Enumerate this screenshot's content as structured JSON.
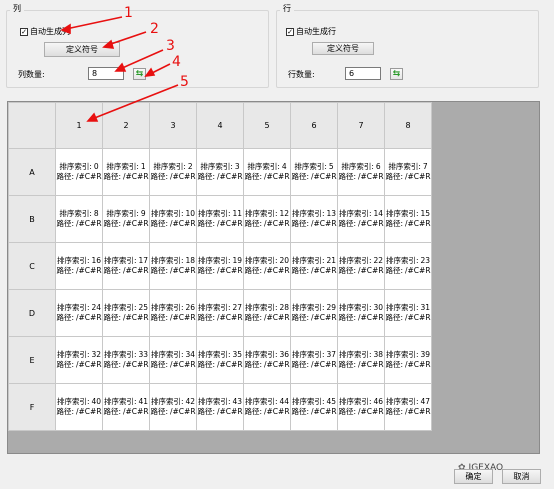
{
  "column_group": {
    "title": "列",
    "auto_generate_label": "自动生成列",
    "auto_generate_checked": "✓",
    "define_symbol_label": "定义符号",
    "count_label": "列数量:",
    "count_value": "8",
    "refresh_glyph": "⇆"
  },
  "row_group": {
    "title": "行",
    "auto_generate_label": "自动生成行",
    "auto_generate_checked": "✓",
    "define_symbol_label": "定义符号",
    "count_label": "行数量:",
    "count_value": "6",
    "refresh_glyph": "⇆"
  },
  "annotations": [
    "1",
    "2",
    "3",
    "4",
    "5"
  ],
  "annotation_color": "#e81010",
  "grid": {
    "column_headers": [
      "1",
      "2",
      "3",
      "4",
      "5",
      "6",
      "7",
      "8"
    ],
    "row_headers": [
      "A",
      "B",
      "C",
      "D",
      "E",
      "F"
    ],
    "cell_index_label": "排序索引:",
    "cell_path_label": "路径:",
    "cell_path_value": "/#C#R",
    "indices": [
      [
        "0",
        "1",
        "2",
        "3",
        "4",
        "5",
        "6",
        "7"
      ],
      [
        "8",
        "9",
        "10",
        "11",
        "12",
        "13",
        "14",
        "15"
      ],
      [
        "16",
        "17",
        "18",
        "19",
        "20",
        "21",
        "22",
        "23"
      ],
      [
        "24",
        "25",
        "26",
        "27",
        "28",
        "29",
        "30",
        "31"
      ],
      [
        "32",
        "33",
        "34",
        "35",
        "36",
        "37",
        "38",
        "39"
      ],
      [
        "40",
        "41",
        "42",
        "43",
        "44",
        "45",
        "46",
        "47"
      ]
    ]
  },
  "footer": {
    "watermark": "IGEXAO",
    "confirm_label": "确定",
    "cancel_label": "取消"
  }
}
